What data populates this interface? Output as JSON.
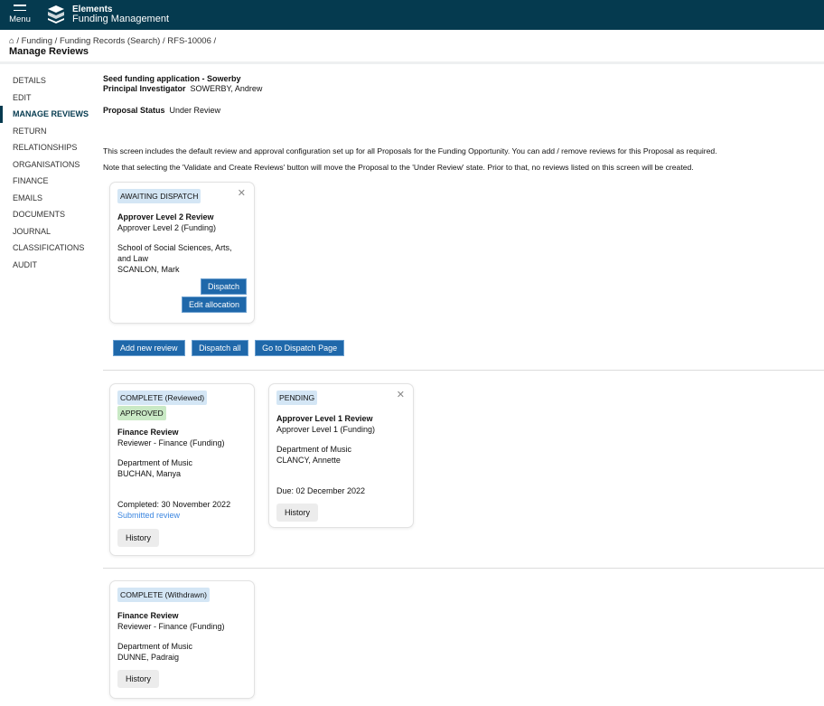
{
  "header": {
    "menu_label": "Menu",
    "brand_top": "Elements",
    "brand_bottom": "Funding Management"
  },
  "breadcrumb": {
    "items": [
      "Funding",
      "Funding Records (Search)",
      "RFS-10006"
    ],
    "title": "Manage Reviews"
  },
  "sidebar": {
    "items": [
      {
        "label": "DETAILS"
      },
      {
        "label": "EDIT"
      },
      {
        "label": "MANAGE REVIEWS"
      },
      {
        "label": "RETURN"
      },
      {
        "label": "RELATIONSHIPS"
      },
      {
        "label": "ORGANISATIONS"
      },
      {
        "label": "FINANCE"
      },
      {
        "label": "EMAILS"
      },
      {
        "label": "DOCUMENTS"
      },
      {
        "label": "JOURNAL"
      },
      {
        "label": "CLASSIFICATIONS"
      },
      {
        "label": "AUDIT"
      }
    ]
  },
  "record": {
    "title": "Seed funding application - Sowerby",
    "pi_label": "Principal Investigator",
    "pi_value": "SOWERBY, Andrew",
    "status_label": "Proposal Status",
    "status_value": "Under Review"
  },
  "intro": [
    "This screen includes the default review and approval configuration set up for all Proposals for the Funding Opportunity. You can add / remove reviews for this Proposal as required.",
    "Note that selecting the 'Validate and Create Reviews' button will move the Proposal to the 'Under Review' state. Prior to that, no reviews listed on this screen will be created."
  ],
  "awaiting": {
    "status": "AWAITING DISPATCH",
    "name": "Approver Level 2 Review",
    "role": "Approver Level 2 (Funding)",
    "dept": "School of Social Sciences, Arts, and Law",
    "person": "SCANLON, Mark",
    "dispatch": "Dispatch",
    "edit": "Edit allocation"
  },
  "actions": {
    "add": "Add new review",
    "dispatch_all": "Dispatch all",
    "go_dispatch": "Go to Dispatch Page"
  },
  "reviewed": {
    "status": "COMPLETE (Reviewed)",
    "outcome": "APPROVED",
    "name": "Finance Review",
    "role": "Reviewer - Finance (Funding)",
    "dept": "Department of Music",
    "person": "BUCHAN, Manya",
    "completed": "Completed: 30 November 2022",
    "link": "Submitted review",
    "history": "History"
  },
  "pending": {
    "status": "PENDING",
    "name": "Approver Level 1 Review",
    "role": "Approver Level 1 (Funding)",
    "dept": "Department of Music",
    "person": "CLANCY, Annette",
    "due": "Due: 02 December 2022",
    "history": "History"
  },
  "withdrawn": {
    "status": "COMPLETE (Withdrawn)",
    "name": "Finance Review",
    "role": "Reviewer - Finance (Funding)",
    "dept": "Department of Music",
    "person": "DUNNE, Padraig",
    "history": "History"
  }
}
